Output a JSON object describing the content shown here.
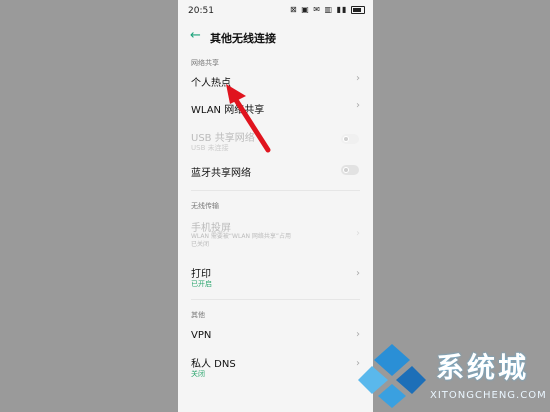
{
  "status": {
    "time": "20:51",
    "icons": "⊠ ▣ ✉ ▥ ▮▮"
  },
  "header": {
    "title": "其他无线连接"
  },
  "sections": {
    "sharing": "网络共享",
    "wireless": "无线传输",
    "other": "其他"
  },
  "rows": {
    "hotspot": "个人热点",
    "wlan_share": "WLAN 网络共享",
    "usb_share": {
      "label": "USB 共享网络",
      "sub": "USB 未连接"
    },
    "bt_share": "蓝牙共享网络",
    "cast": {
      "label": "手机投屏",
      "desc1": "WLAN 需要被“WLAN 网络共享”占用",
      "desc2": "已关闭"
    },
    "print": {
      "label": "打印",
      "sub": "已开启"
    },
    "vpn": "VPN",
    "dns": {
      "label": "私人 DNS",
      "sub": "关闭"
    }
  },
  "watermark": {
    "text": "系统城",
    "sub": "XITONGCHENG.COM"
  },
  "colors": {
    "accent": "#1aa37a",
    "arrow": "#e0141e"
  }
}
